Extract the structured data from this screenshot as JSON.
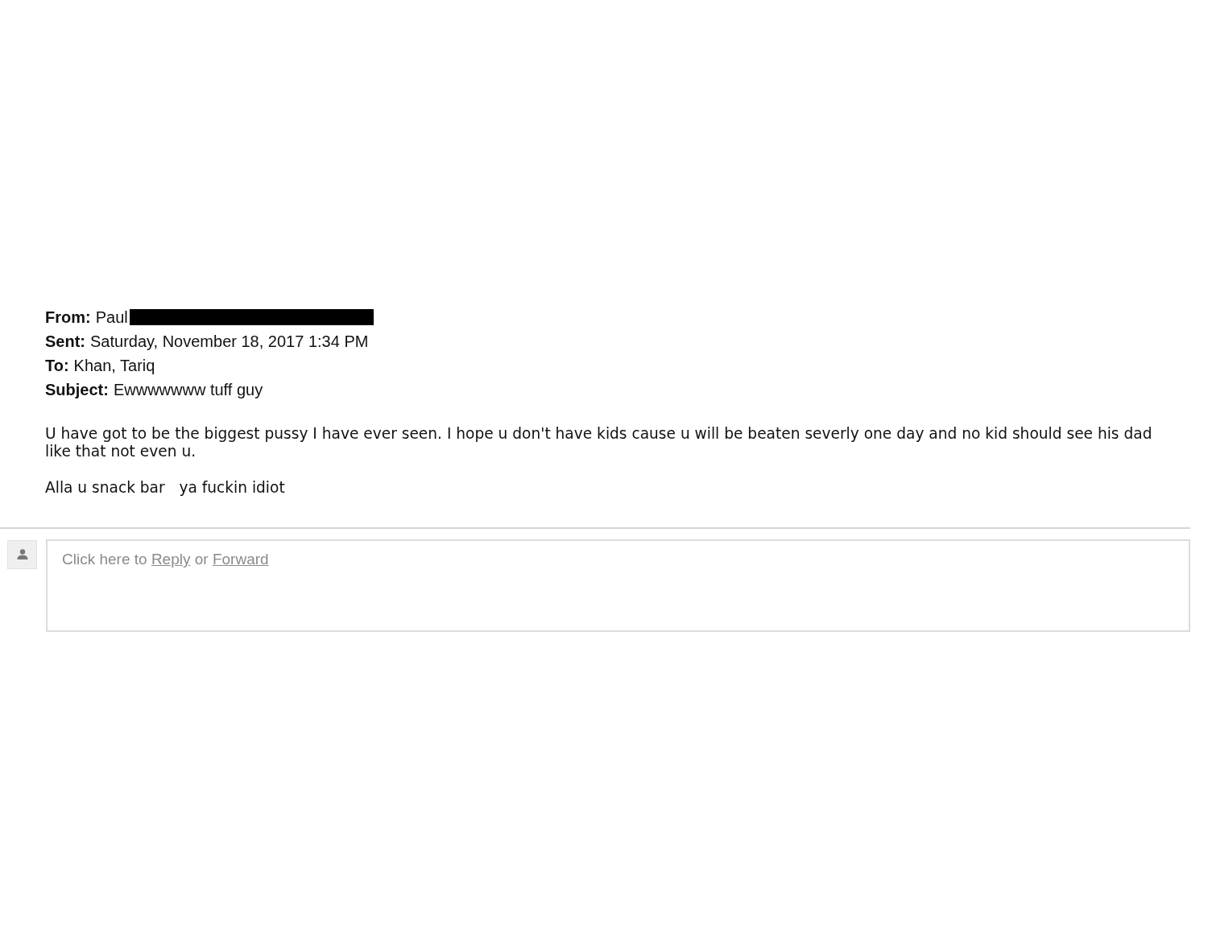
{
  "headers": [
    {
      "label": "From:",
      "value": "Paul",
      "redacted": true
    },
    {
      "label": "Sent:",
      "value": "Saturday, November 18, 2017 1:34 PM",
      "redacted": false
    },
    {
      "label": "To:",
      "value": "Khan, Tariq",
      "redacted": false
    },
    {
      "label": "Subject:",
      "value": "Ewwwwwww tuff guy",
      "redacted": false
    }
  ],
  "body": [
    "U have got to be the biggest pussy I have ever seen. I hope u don't have kids cause u will be beaten severly one day and no kid should see his dad like that not even u.",
    "Alla u snack bar   ya fuckin idiot"
  ],
  "reply_box": {
    "parts": [
      {
        "kind": "text",
        "text": "Click here to "
      },
      {
        "kind": "link",
        "text": "Reply"
      },
      {
        "kind": "text",
        "text": " or "
      },
      {
        "kind": "link",
        "text": "Forward"
      }
    ]
  }
}
